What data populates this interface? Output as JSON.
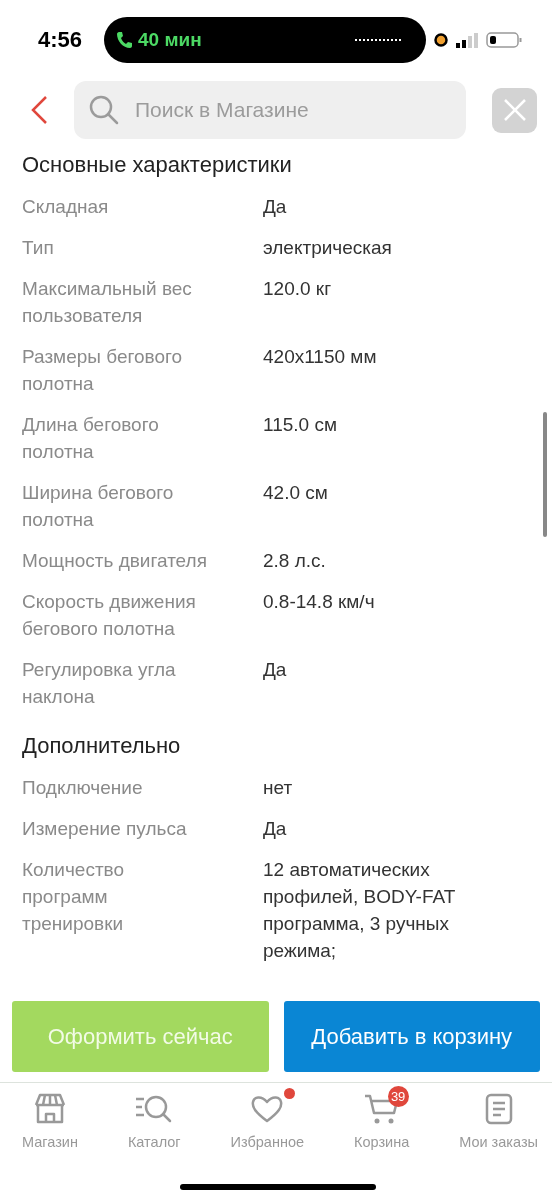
{
  "status_bar": {
    "time": "4:56",
    "call": "40 мин"
  },
  "search": {
    "placeholder": "Поиск в Магазине"
  },
  "sections": [
    {
      "title": "Основные характеристики",
      "rows": [
        {
          "label": "Складная",
          "value": "Да"
        },
        {
          "label": "Тип",
          "value": "электрическая"
        },
        {
          "label": "Максимальный вес пользователя",
          "value": "120.0 кг"
        },
        {
          "label": "Размеры бегового полотна",
          "value": "420x1150 мм"
        },
        {
          "label": "Длина бегового полотна",
          "value": "115.0 см"
        },
        {
          "label": "Ширина бегового полотна",
          "value": "42.0 см"
        },
        {
          "label": "Мощность двигателя",
          "value": "2.8 л.с."
        },
        {
          "label": "Скорость движения бегового полотна",
          "value": "0.8-14.8 км/ч"
        },
        {
          "label": "Регулировка угла наклона",
          "value": "Да"
        }
      ]
    },
    {
      "title": "Дополнительно",
      "rows": [
        {
          "label": "Подключение",
          "value": "нет"
        },
        {
          "label": "Измерение пульса",
          "value": "Да"
        },
        {
          "label": "Количество программ тренировки",
          "value": "12 автоматических профилей, BODY-FAT программа, 3 ручных режима;"
        }
      ]
    }
  ],
  "actions": [
    {
      "kind": "buy",
      "label": "Оформить сейчас"
    },
    {
      "kind": "cart",
      "label": "Добавить в корзину"
    }
  ],
  "nav": [
    {
      "kind": "shop",
      "label": "Магазин",
      "dot": false
    },
    {
      "kind": "catalog",
      "label": "Каталог",
      "dot": false
    },
    {
      "kind": "heart",
      "label": "Избранное",
      "dot": true
    },
    {
      "kind": "cart",
      "label": "Корзина",
      "dot": false,
      "badge": "39"
    },
    {
      "kind": "orders",
      "label": "Мои заказы",
      "dot": false
    }
  ]
}
